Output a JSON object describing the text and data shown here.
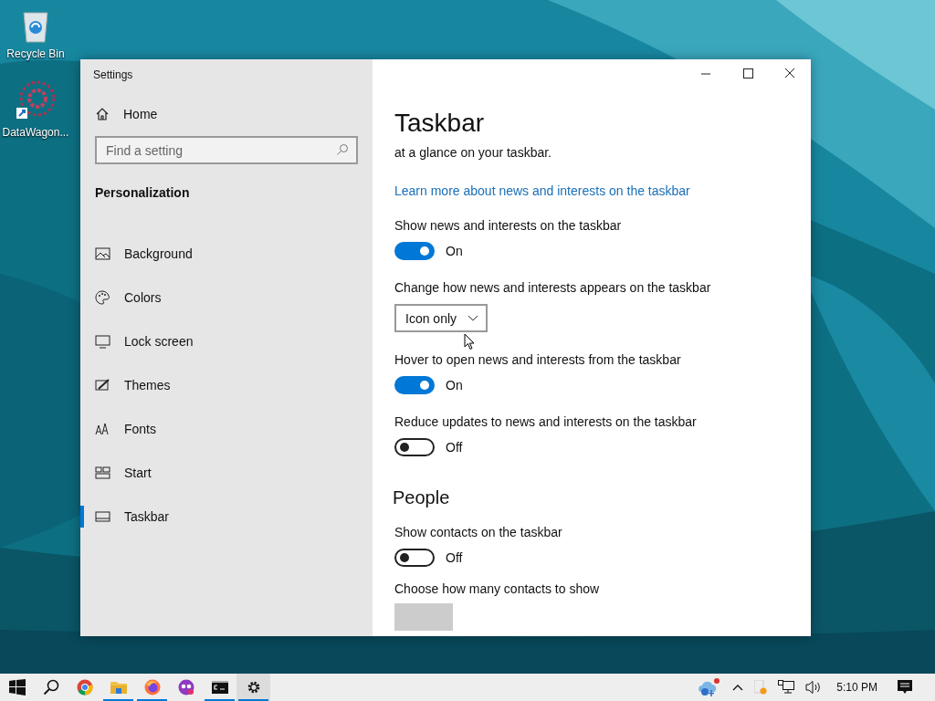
{
  "desktop_icons": [
    {
      "label": "Recycle Bin",
      "kind": "recycle"
    },
    {
      "label": "DataWagon...",
      "kind": "shortcut"
    }
  ],
  "window": {
    "title": "Settings"
  },
  "sidebar": {
    "home": "Home",
    "search": {
      "placeholder": "Find a setting"
    },
    "section": "Personalization",
    "items": [
      {
        "label": "Background",
        "kind": "background",
        "selected": false
      },
      {
        "label": "Colors",
        "kind": "colors",
        "selected": false
      },
      {
        "label": "Lock screen",
        "kind": "lock",
        "selected": false
      },
      {
        "label": "Themes",
        "kind": "themes",
        "selected": false
      },
      {
        "label": "Fonts",
        "kind": "fonts",
        "selected": false
      },
      {
        "label": "Start",
        "kind": "start",
        "selected": false
      },
      {
        "label": "Taskbar",
        "kind": "taskbar",
        "selected": true
      }
    ]
  },
  "content": {
    "heading": "Taskbar",
    "blocks": [
      {
        "kind": "text",
        "text": "at a glance on your taskbar."
      },
      {
        "kind": "link",
        "text": "Learn more about news and interests on the taskbar"
      },
      {
        "kind": "toggle",
        "label": "Show news and interests on the taskbar",
        "on": true,
        "state_text": "On"
      },
      {
        "kind": "dropdown",
        "label": "Change how news and interests appears on the taskbar",
        "value": "Icon only"
      },
      {
        "kind": "toggle",
        "label": "Hover to open news and interests from the taskbar",
        "on": true,
        "state_text": "On"
      },
      {
        "kind": "toggle",
        "label": "Reduce updates to news and interests on the taskbar",
        "on": false,
        "state_text": "Off"
      },
      {
        "kind": "heading",
        "text": "People"
      },
      {
        "kind": "toggle",
        "label": "Show contacts on the taskbar",
        "on": false,
        "state_text": "Off"
      },
      {
        "kind": "label",
        "text": "Choose how many contacts to show"
      },
      {
        "kind": "partial"
      }
    ]
  },
  "taskbar": {
    "apps": [
      {
        "kind": "start",
        "running": false,
        "active": false
      },
      {
        "kind": "search",
        "running": false,
        "active": false
      },
      {
        "kind": "chrome",
        "running": false,
        "active": false
      },
      {
        "kind": "explorer",
        "running": true,
        "active": false
      },
      {
        "kind": "firefox",
        "running": true,
        "active": false
      },
      {
        "kind": "purple",
        "running": false,
        "active": false
      },
      {
        "kind": "cmd",
        "running": true,
        "active": false
      },
      {
        "kind": "settings",
        "running": true,
        "active": true
      }
    ],
    "clock": "5:10 PM"
  }
}
